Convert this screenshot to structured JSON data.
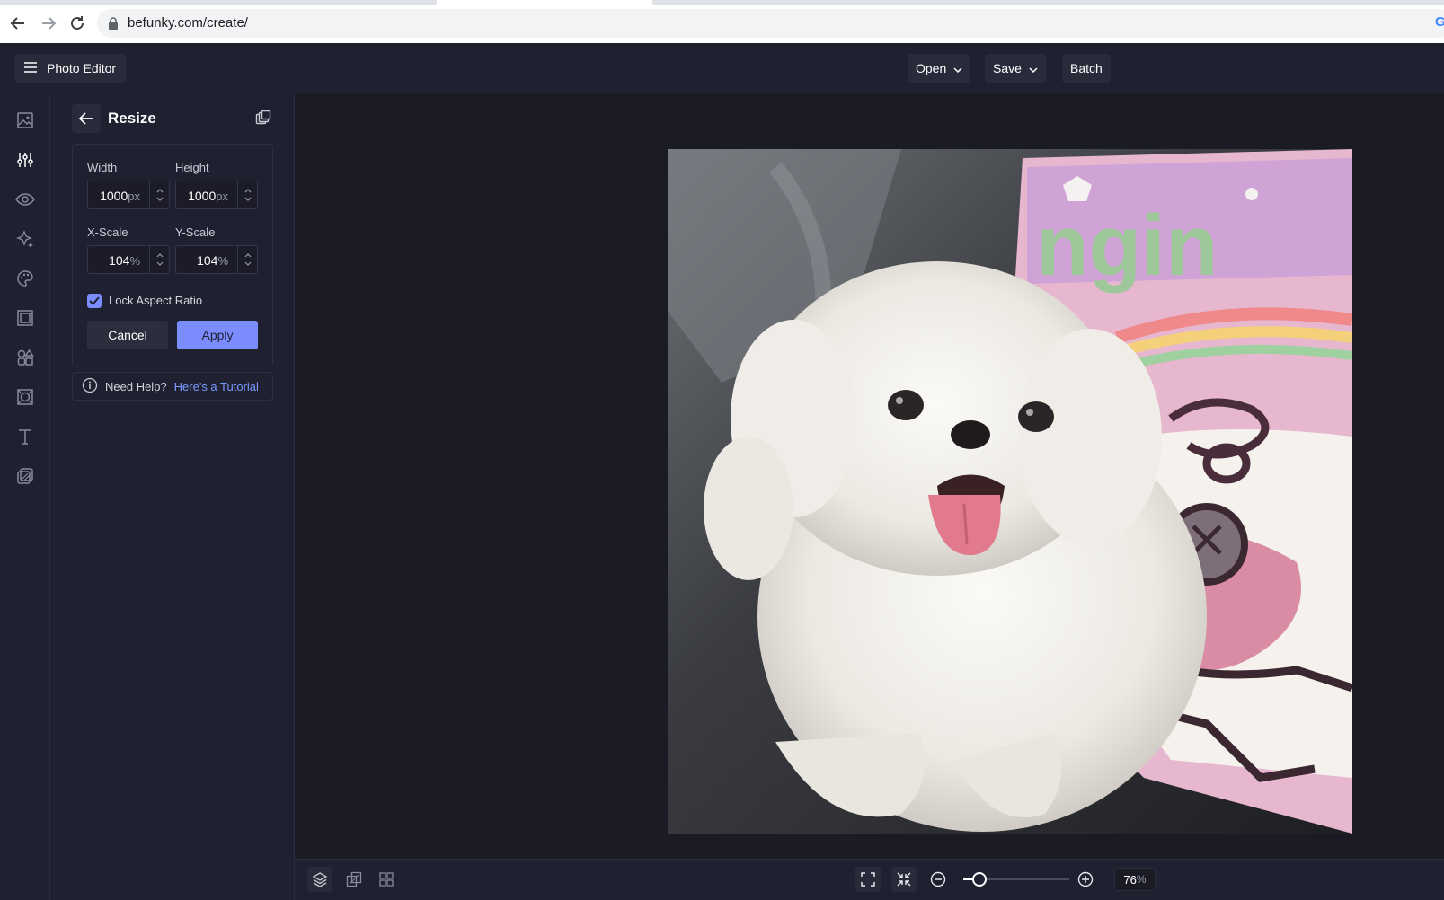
{
  "browser": {
    "url": "befunky.com/create/",
    "google_mark": "G"
  },
  "header": {
    "menu_label": "Photo Editor",
    "open_label": "Open",
    "save_label": "Save",
    "batch_label": "Batch"
  },
  "rail": {
    "items": [
      {
        "icon": "image-icon"
      },
      {
        "icon": "sliders-icon",
        "active": true
      },
      {
        "icon": "eye-icon"
      },
      {
        "icon": "sparkle-icon"
      },
      {
        "icon": "palette-icon"
      },
      {
        "icon": "frame-icon"
      },
      {
        "icon": "shapes-icon"
      },
      {
        "icon": "texture-icon"
      },
      {
        "icon": "text-icon"
      },
      {
        "icon": "overlay-icon"
      }
    ]
  },
  "panel": {
    "title": "Resize",
    "width_label": "Width",
    "width_value": "1000",
    "width_unit": "px",
    "height_label": "Height",
    "height_value": "1000",
    "height_unit": "px",
    "xscale_label": "X-Scale",
    "xscale_value": "104",
    "xscale_unit": "%",
    "yscale_label": "Y-Scale",
    "yscale_value": "104",
    "yscale_unit": "%",
    "lock_label": "Lock Aspect Ratio",
    "lock_checked": true,
    "cancel_label": "Cancel",
    "apply_label": "Apply",
    "help_text": "Need Help?",
    "help_link": "Here's a Tutorial"
  },
  "canvas": {
    "photo_text": "ngin"
  },
  "bottom": {
    "zoom_value": "76",
    "zoom_unit": "%",
    "zoom_slider_fraction": 0.15
  },
  "colors": {
    "accent": "#7b8cff",
    "bg": "#1c1d27",
    "panel": "#1f2030"
  }
}
